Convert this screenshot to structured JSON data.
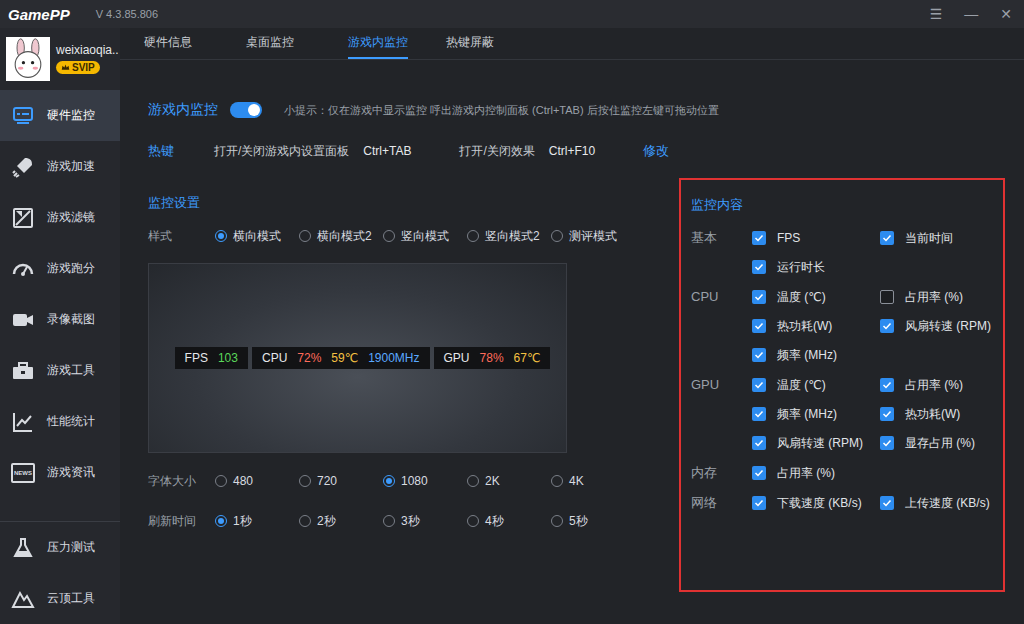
{
  "app": {
    "logo": "GamePP",
    "version": "V 4.3.85.806",
    "controls": [
      "☰",
      "—",
      "✕"
    ]
  },
  "user": {
    "name": "weixiaoqia..",
    "badge": "SVIP"
  },
  "sidebar": {
    "items": [
      {
        "label": "硬件监控",
        "selected": true
      },
      {
        "label": "游戏加速",
        "selected": false
      },
      {
        "label": "游戏滤镜",
        "selected": false
      },
      {
        "label": "游戏跑分",
        "selected": false
      },
      {
        "label": "录像截图",
        "selected": false
      },
      {
        "label": "游戏工具",
        "selected": false
      },
      {
        "label": "性能统计",
        "selected": false
      },
      {
        "label": "游戏资讯",
        "selected": false,
        "icon_text": "NEWS"
      }
    ],
    "bottom_items": [
      {
        "label": "压力测试",
        "selected": false
      },
      {
        "label": "云顶工具",
        "selected": false
      }
    ]
  },
  "tabs": [
    {
      "label": "硬件信息",
      "selected": false
    },
    {
      "label": "桌面监控",
      "selected": false
    },
    {
      "label": "游戏内监控",
      "selected": true
    },
    {
      "label": "热键屏蔽",
      "selected": false
    }
  ],
  "in_game_monitor": {
    "label": "游戏内监控",
    "on": true,
    "tip": "小提示：仅在游戏中显示监控 呼出游戏内控制面板 (Ctrl+TAB) 后按住监控左键可拖动位置"
  },
  "hotkeys": {
    "label": "热键",
    "items": [
      {
        "label": "打开/关闭游戏内设置面板",
        "key": "Ctrl+TAB"
      },
      {
        "label": "打开/关闭效果",
        "key": "Ctrl+F10"
      }
    ],
    "edit": "修改"
  },
  "settings": {
    "title": "监控设置",
    "style": {
      "label": "样式",
      "options": [
        {
          "label": "横向模式",
          "selected": true
        },
        {
          "label": "横向模式2",
          "selected": false
        },
        {
          "label": "竖向模式",
          "selected": false
        },
        {
          "label": "竖向模式2",
          "selected": false
        },
        {
          "label": "测评模式",
          "selected": false
        }
      ]
    },
    "preview": {
      "segments": [
        {
          "label": "FPS",
          "values": [
            {
              "text": "103",
              "color": "#5ad85a"
            }
          ]
        },
        {
          "label": "CPU",
          "values": [
            {
              "text": "72%",
              "color": "#ff6b5a"
            },
            {
              "text": "59℃",
              "color": "#f5c242"
            },
            {
              "text": "1900MHz",
              "color": "#5aa9ff"
            }
          ]
        },
        {
          "label": "GPU",
          "values": [
            {
              "text": "78%",
              "color": "#ff6b5a"
            },
            {
              "text": "67℃",
              "color": "#f5c242"
            }
          ]
        }
      ]
    },
    "font_size": {
      "label": "字体大小",
      "options": [
        {
          "label": "480",
          "selected": false
        },
        {
          "label": "720",
          "selected": false
        },
        {
          "label": "1080",
          "selected": true
        },
        {
          "label": "2K",
          "selected": false
        },
        {
          "label": "4K",
          "selected": false
        }
      ]
    },
    "refresh": {
      "label": "刷新时间",
      "options": [
        {
          "label": "1秒",
          "selected": true
        },
        {
          "label": "2秒",
          "selected": false
        },
        {
          "label": "3秒",
          "selected": false
        },
        {
          "label": "4秒",
          "selected": false
        },
        {
          "label": "5秒",
          "selected": false
        }
      ]
    }
  },
  "monitor_content": {
    "title": "监控内容",
    "groups": [
      {
        "label": "基本",
        "items": [
          {
            "label": "FPS",
            "checked": true
          },
          {
            "label": "当前时间",
            "checked": true
          },
          {
            "label": "运行时长",
            "checked": true
          }
        ]
      },
      {
        "label": "CPU",
        "items": [
          {
            "label": "温度 (℃)",
            "checked": true
          },
          {
            "label": "占用率 (%)",
            "checked": false
          },
          {
            "label": "热功耗(W)",
            "checked": true
          },
          {
            "label": "风扇转速 (RPM)",
            "checked": true
          },
          {
            "label": "频率 (MHz)",
            "checked": true
          }
        ]
      },
      {
        "label": "GPU",
        "items": [
          {
            "label": "温度 (℃)",
            "checked": true
          },
          {
            "label": "占用率 (%)",
            "checked": true
          },
          {
            "label": "频率 (MHz)",
            "checked": true
          },
          {
            "label": "热功耗(W)",
            "checked": true
          },
          {
            "label": "风扇转速 (RPM)",
            "checked": true
          },
          {
            "label": "显存占用 (%)",
            "checked": true
          }
        ]
      },
      {
        "label": "内存",
        "items": [
          {
            "label": "占用率 (%)",
            "checked": true
          }
        ]
      },
      {
        "label": "网络",
        "items": [
          {
            "label": "下载速度 (KB/s)",
            "checked": true
          },
          {
            "label": "上传速度 (KB/s)",
            "checked": true
          }
        ]
      }
    ]
  }
}
